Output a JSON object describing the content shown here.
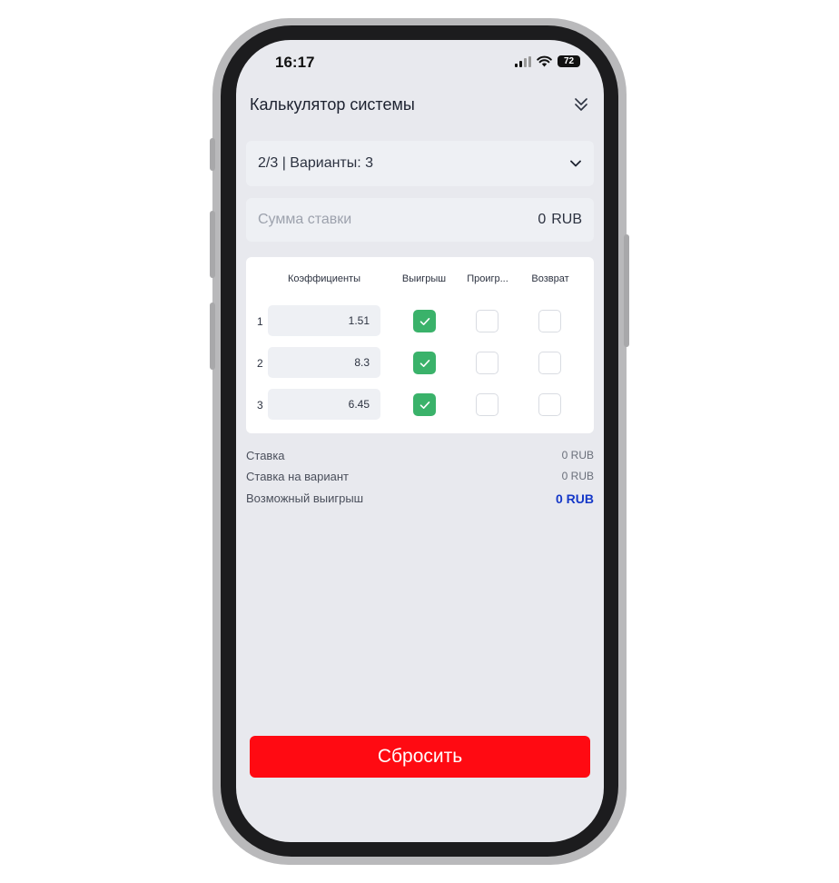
{
  "status_bar": {
    "time": "16:17",
    "battery": "72"
  },
  "header": {
    "title": "Калькулятор системы"
  },
  "system_selector": {
    "label": "2/3 | Варианты: 3"
  },
  "stake": {
    "placeholder": "Сумма ставки",
    "amount": "0",
    "currency": "RUB"
  },
  "table": {
    "headers": {
      "odds": "Коэффициенты",
      "win": "Выигрыш",
      "lose": "Проигр...",
      "return": "Возврат"
    },
    "rows": [
      {
        "num": "1",
        "odds": "1.51",
        "win": true,
        "lose": false,
        "return": false
      },
      {
        "num": "2",
        "odds": "8.3",
        "win": true,
        "lose": false,
        "return": false
      },
      {
        "num": "3",
        "odds": "6.45",
        "win": true,
        "lose": false,
        "return": false
      }
    ]
  },
  "summary": {
    "stake_label": "Ставка",
    "stake_value": "0 RUB",
    "per_variant_label": "Ставка на вариант",
    "per_variant_value": "0 RUB",
    "possible_win_label": "Возможный выигрыш",
    "possible_win_value": "0 RUB"
  },
  "reset_button": {
    "label": "Сбросить"
  },
  "colors": {
    "accent_red": "#ff0a12",
    "checked_green": "#3ab26a",
    "win_blue": "#1538c8"
  }
}
